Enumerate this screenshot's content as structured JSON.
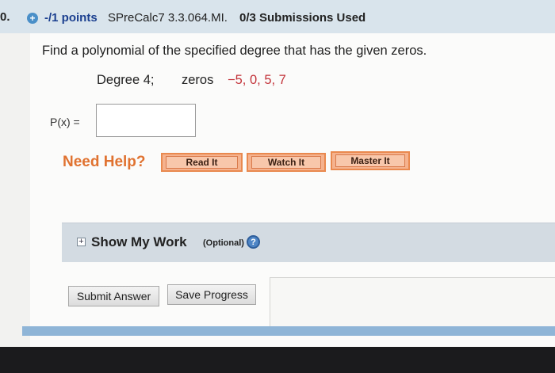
{
  "header": {
    "question_number": "0.",
    "points": "-/1 points",
    "assignment_id": "SPreCalc7 3.3.064.MI.",
    "submissions": "0/3 Submissions Used"
  },
  "question": {
    "prompt": "Find a polynomial of the specified degree that has the given zeros.",
    "degree_label": "Degree 4;",
    "zeros_label": "zeros",
    "zeros_values": "−5, 0, 5, 7"
  },
  "answer": {
    "label": "P(x) =",
    "value": ""
  },
  "help": {
    "label": "Need Help?",
    "buttons": [
      "Read It",
      "Watch It",
      "Master It"
    ]
  },
  "show_work": {
    "label": "Show My Work",
    "optional": "(Optional)",
    "help_glyph": "?"
  },
  "actions": {
    "submit_label": "Submit Answer",
    "save_label": "Save Progress"
  },
  "colors": {
    "points": "#1b3f8f",
    "zeros": "#c3333a",
    "need_help": "#e07230",
    "help_button": "#f5b28e"
  },
  "icons": [
    "plus-circle-icon",
    "expand-icon",
    "help-question-icon"
  ]
}
